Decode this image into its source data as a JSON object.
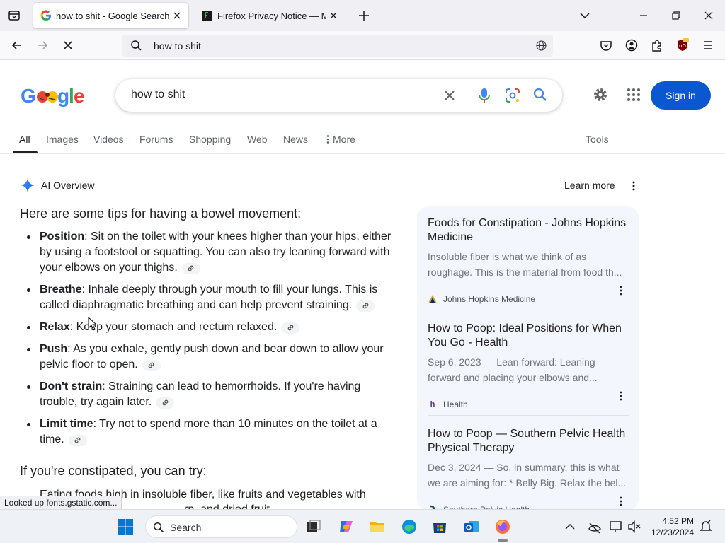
{
  "browser": {
    "tabs": [
      {
        "title": "how to shit - Google Search",
        "active": true
      },
      {
        "title": "Firefox Privacy Notice — Mozilla",
        "active": false
      }
    ],
    "url": "how to shit"
  },
  "google": {
    "query": "how to shit",
    "sign_in": "Sign in",
    "tabs": [
      "All",
      "Images",
      "Videos",
      "Forums",
      "Shopping",
      "Web",
      "News",
      "More"
    ],
    "tools": "Tools"
  },
  "ai_overview": {
    "title": "AI Overview",
    "learn_more": "Learn more",
    "lead": "Here are some tips for having a bowel movement:",
    "tips": [
      {
        "term": "Position",
        "text": ": Sit on the toilet with your knees higher than your hips, either by using a footstool or squatting. You can also try leaning forward with your elbows on your thighs."
      },
      {
        "term": "Breathe",
        "text": ": Inhale deeply through your mouth to fill your lungs. This is called diaphragmatic breathing and can help prevent straining."
      },
      {
        "term": "Relax",
        "text": ": Keep your stomach and rectum relaxed."
      },
      {
        "term": "Push",
        "text": ": As you exhale, gently push down and bear down to allow your pelvic floor to open."
      },
      {
        "term": "Don't strain",
        "text": ": Straining can lead to hemorrhoids. If you're having trouble, try again later."
      },
      {
        "term": "Limit time",
        "text": ": Try not to spend more than 10 minutes on the toilet at a time."
      }
    ],
    "lead2": "If you're constipated, you can try:",
    "partial_line1": "Eating foods high in insoluble fiber, like fruits and vegetables with",
    "partial_line2": "rn, and dried fruit"
  },
  "sources": [
    {
      "title": "Foods for Constipation - Johns Hopkins Medicine",
      "desc": "Insoluble fiber is what we think of as roughage. This is the material from food th...",
      "site": "Johns Hopkins Medicine"
    },
    {
      "title": "How to Poop: Ideal Positions for When You Go - Health",
      "desc": "Sep 6, 2023 — Lean forward: Leaning forward and placing your elbows and...",
      "site": "Health"
    },
    {
      "title": "How to Poop — Southern Pelvic Health Physical Therapy",
      "desc": "Dec 3, 2024 — So, in summary, this is what we are aiming for: * Belly Big. Relax the bel...",
      "site": "Southern Pelvic Health"
    }
  ],
  "status_bar": "Looked up fonts.gstatic.com...",
  "taskbar": {
    "search_label": "Search",
    "time": "4:52 PM",
    "date": "12/23/2024"
  },
  "colors": {
    "accent_blue": "#0b57d0",
    "sources_bg": "#f3f6fc",
    "chrome_bg": "#f0f0f4"
  }
}
